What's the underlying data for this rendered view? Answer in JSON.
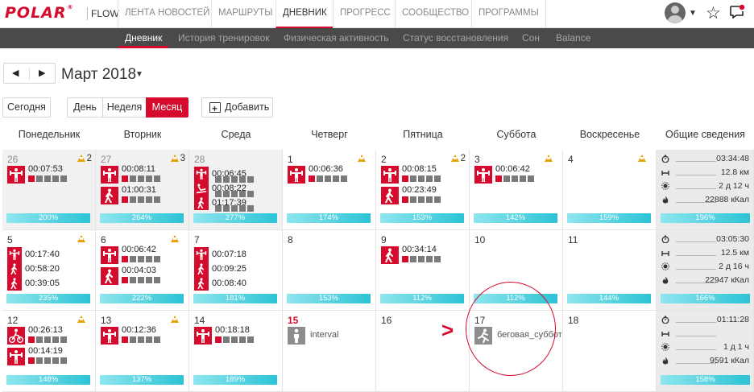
{
  "header": {
    "logo": "POLAR",
    "logo_mark": "®",
    "app": "FLOW",
    "nav": [
      "ЛЕНТА НОВОСТЕЙ",
      "МАРШРУТЫ",
      "ДНЕВНИК",
      "ПРОГРЕСС",
      "СООБЩЕСТВО",
      "ПРОГРАММЫ"
    ],
    "nav_active": "ДНЕВНИК"
  },
  "subnav": {
    "items": [
      "Дневник",
      "История тренировок",
      "Физическая активность",
      "Статус восстановления",
      "Сон",
      "Balance"
    ],
    "active": "Дневник"
  },
  "calendar": {
    "month_label": "Март 2018",
    "today_label": "Сегодня",
    "views": [
      "День",
      "Неделя",
      "Месяц"
    ],
    "active_view": "Месяц",
    "add_label": "Добавить",
    "columns": [
      "Понедельник",
      "Вторник",
      "Среда",
      "Четверг",
      "Пятница",
      "Суббота",
      "Воскресенье",
      "Общие сведения"
    ],
    "weeks": [
      {
        "days": [
          {
            "day": "26",
            "prev": true,
            "warn": "2",
            "load": "200%",
            "load_fraction": 0.95,
            "events": [
              {
                "icon": "strength-icon",
                "time": "00:07:53",
                "zones": 1
              }
            ]
          },
          {
            "day": "27",
            "prev": true,
            "warn": "3",
            "load": "264%",
            "load_fraction": 0.95,
            "events": [
              {
                "icon": "strength-icon",
                "time": "00:08:11",
                "zones": 1
              },
              {
                "icon": "walking-icon",
                "time": "01:00:31",
                "zones": 1
              }
            ]
          },
          {
            "day": "28",
            "prev": true,
            "warn": "",
            "load": "277%",
            "load_fraction": 0.95,
            "events": [
              {
                "icon": "strength-icon",
                "time": "00:06:45",
                "zones": 0
              },
              {
                "icon": "other-sport-icon",
                "time": "00:08:22",
                "zones": 0
              },
              {
                "icon": "walking-icon",
                "time": "01:17:39",
                "zones": 0
              }
            ]
          },
          {
            "day": "1",
            "warn": "",
            "warn_icon": true,
            "load": "174%",
            "load_fraction": 0.95,
            "events": [
              {
                "icon": "strength-icon",
                "time": "00:06:36",
                "zones": 1
              }
            ]
          },
          {
            "day": "2",
            "warn": "2",
            "load": "153%",
            "load_fraction": 0.95,
            "events": [
              {
                "icon": "strength-icon",
                "time": "00:08:15",
                "zones": 1
              },
              {
                "icon": "walking-icon",
                "time": "00:23:49",
                "zones": 1
              }
            ]
          },
          {
            "day": "3",
            "warn": "",
            "warn_icon": true,
            "load": "142%",
            "load_fraction": 0.95,
            "events": [
              {
                "icon": "strength-icon",
                "time": "00:06:42",
                "zones": 1
              }
            ]
          },
          {
            "day": "4",
            "warn": "",
            "warn_icon": true,
            "load": "159%",
            "load_fraction": 0.95,
            "events": []
          }
        ],
        "summary": {
          "duration": "03:34:48",
          "distance": "12.8 км",
          "recovery": "2 д 12 ч",
          "calories": "22888 кКал",
          "load": "196%"
        }
      },
      {
        "days": [
          {
            "day": "5",
            "warn": "",
            "warn_icon": true,
            "load": "235%",
            "load_fraction": 0.95,
            "events": [
              {
                "icon": "strength-icon",
                "time": "00:17:40",
                "zones": 0
              },
              {
                "icon": "walking-icon",
                "time": "00:58:20",
                "zones": 0
              },
              {
                "icon": "walking-icon",
                "time": "00:39:05",
                "zones": 0
              }
            ]
          },
          {
            "day": "6",
            "warn": "",
            "warn_icon": true,
            "load": "222%",
            "load_fraction": 0.95,
            "events": [
              {
                "icon": "strength-icon",
                "time": "00:06:42",
                "zones": 1
              },
              {
                "icon": "walking-icon",
                "time": "00:04:03",
                "zones": 1
              }
            ]
          },
          {
            "day": "7",
            "warn": "",
            "load": "181%",
            "load_fraction": 0.95,
            "events": [
              {
                "icon": "strength-icon",
                "time": "00:07:18",
                "zones": 0
              },
              {
                "icon": "walking-icon",
                "time": "00:09:25",
                "zones": 0
              },
              {
                "icon": "walking-icon",
                "time": "00:08:40",
                "zones": 0
              }
            ]
          },
          {
            "day": "8",
            "warn": "",
            "load": "153%",
            "load_fraction": 0.95,
            "events": []
          },
          {
            "day": "9",
            "warn": "",
            "load": "112%",
            "load_fraction": 0.95,
            "events": [
              {
                "icon": "walking-icon",
                "time": "00:34:14",
                "zones": 1
              }
            ]
          },
          {
            "day": "10",
            "warn": "",
            "load": "112%",
            "load_fraction": 0.95,
            "events": []
          },
          {
            "day": "11",
            "warn": "",
            "load": "144%",
            "load_fraction": 0.95,
            "events": []
          }
        ],
        "summary": {
          "duration": "03:05:30",
          "distance": "12.5 км",
          "recovery": "2 д 16 ч",
          "calories": "22947 кКал",
          "load": "166%"
        }
      },
      {
        "days": [
          {
            "day": "12",
            "warn": "",
            "warn_icon": true,
            "load": "148%",
            "load_fraction": 0.95,
            "events": [
              {
                "icon": "cycling-icon",
                "time": "00:26:13",
                "zones": 0
              },
              {
                "icon": "strength-icon",
                "time": "00:14:19",
                "zones": 0
              }
            ]
          },
          {
            "day": "13",
            "warn": "",
            "warn_icon": true,
            "load": "137%",
            "load_fraction": 0.95,
            "events": [
              {
                "icon": "strength-icon",
                "time": "00:12:36",
                "zones": 1
              }
            ]
          },
          {
            "day": "14",
            "warn": "",
            "load": "189%",
            "load_fraction": 0.95,
            "events": [
              {
                "icon": "strength-icon",
                "time": "00:18:18",
                "zones": 1
              }
            ]
          },
          {
            "day": "15",
            "today": true,
            "warn": "",
            "load": "",
            "events": [
              {
                "icon": "person-icon",
                "grey": true,
                "title": "interval"
              }
            ]
          },
          {
            "day": "16",
            "warn": "",
            "load": "",
            "events": []
          },
          {
            "day": "17",
            "warn": "",
            "load": "",
            "events": [
              {
                "icon": "running-icon",
                "grey": true,
                "title": "беговая_суббота"
              }
            ]
          },
          {
            "day": "18",
            "warn": "",
            "load": "",
            "events": []
          }
        ],
        "summary": {
          "duration": "01:11:28",
          "distance": "",
          "recovery": "1 д 1 ч",
          "calories": "9591 кКал",
          "load": "158%"
        }
      }
    ]
  },
  "annotation": {
    "arrow": ">"
  },
  "colors": {
    "brand": "#d50a2c",
    "load_bar": "#2cc3d5",
    "warning": "#e6a000",
    "subnav_bg": "#4a4a4a"
  }
}
